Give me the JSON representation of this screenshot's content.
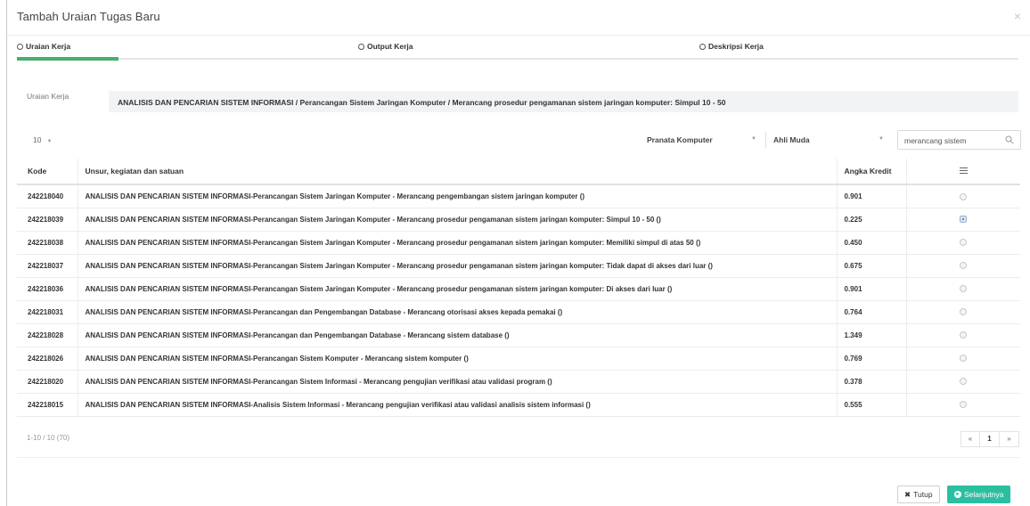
{
  "modal": {
    "title": "Tambah Uraian Tugas Baru",
    "close_glyph": "×"
  },
  "steps": [
    {
      "label": "Uraian Kerja",
      "active": true
    },
    {
      "label": "Output Kerja",
      "active": false
    },
    {
      "label": "Deskripsi Kerja",
      "active": false
    }
  ],
  "accent_progress_color": "#45b06a",
  "uraian": {
    "label": "Uraian Kerja",
    "value": "ANALISIS DAN PENCARIAN SISTEM INFORMASI / Perancangan Sistem Jaringan Komputer / Merancang prosedur pengamanan sistem jaringan komputer: Simpul 10 - 50"
  },
  "filters": {
    "page_size": "10",
    "jabatan": "Pranata Komputer",
    "jenjang": "Ahli Muda",
    "search_value": "merancang sistem"
  },
  "table": {
    "headers": {
      "kode": "Kode",
      "unsur": "Unsur, kegiatan dan satuan",
      "angka_kredit": "Angka Kredit"
    },
    "rows": [
      {
        "kode": "242218040",
        "unsur": "ANALISIS DAN PENCARIAN SISTEM INFORMASI-Perancangan Sistem Jaringan Komputer - Merancang pengembangan sistem jaringan komputer ()",
        "ak": "0.901",
        "selected": false
      },
      {
        "kode": "242218039",
        "unsur": "ANALISIS DAN PENCARIAN SISTEM INFORMASI-Perancangan Sistem Jaringan Komputer - Merancang prosedur pengamanan sistem jaringan komputer: Simpul 10 - 50 ()",
        "ak": "0.225",
        "selected": true
      },
      {
        "kode": "242218038",
        "unsur": "ANALISIS DAN PENCARIAN SISTEM INFORMASI-Perancangan Sistem Jaringan Komputer - Merancang prosedur pengamanan sistem jaringan komputer: Memiliki simpul di atas 50 ()",
        "ak": "0.450",
        "selected": false
      },
      {
        "kode": "242218037",
        "unsur": "ANALISIS DAN PENCARIAN SISTEM INFORMASI-Perancangan Sistem Jaringan Komputer - Merancang prosedur pengamanan sistem jaringan komputer: Tidak dapat di akses dari luar ()",
        "ak": "0.675",
        "selected": false
      },
      {
        "kode": "242218036",
        "unsur": "ANALISIS DAN PENCARIAN SISTEM INFORMASI-Perancangan Sistem Jaringan Komputer - Merancang prosedur pengamanan sistem jaringan komputer: Di akses dari luar ()",
        "ak": "0.901",
        "selected": false
      },
      {
        "kode": "242218031",
        "unsur": "ANALISIS DAN PENCARIAN SISTEM INFORMASI-Perancangan dan Pengembangan Database - Merancang otorisasi akses kepada pemakai ()",
        "ak": "0.764",
        "selected": false
      },
      {
        "kode": "242218028",
        "unsur": "ANALISIS DAN PENCARIAN SISTEM INFORMASI-Perancangan dan Pengembangan Database - Merancang sistem database ()",
        "ak": "1.349",
        "selected": false
      },
      {
        "kode": "242218026",
        "unsur": "ANALISIS DAN PENCARIAN SISTEM INFORMASI-Perancangan Sistem Komputer - Merancang sistem komputer ()",
        "ak": "0.769",
        "selected": false
      },
      {
        "kode": "242218020",
        "unsur": "ANALISIS DAN PENCARIAN SISTEM INFORMASI-Perancangan Sistem Informasi - Merancang pengujian verifikasi atau validasi program ()",
        "ak": "0.378",
        "selected": false
      },
      {
        "kode": "242218015",
        "unsur": "ANALISIS DAN PENCARIAN SISTEM INFORMASI-Analisis Sistem Informasi - Merancang pengujian verifikasi atau validasi analisis sistem informasi ()",
        "ak": "0.555",
        "selected": false
      }
    ]
  },
  "pagination": {
    "summary": "1-10 / 10 (70)",
    "prev": "«",
    "current": "1",
    "next": "»"
  },
  "footer": {
    "close_label": "Tutup",
    "next_label": "Selanjutnya",
    "next_color": "#2bbfa1"
  }
}
